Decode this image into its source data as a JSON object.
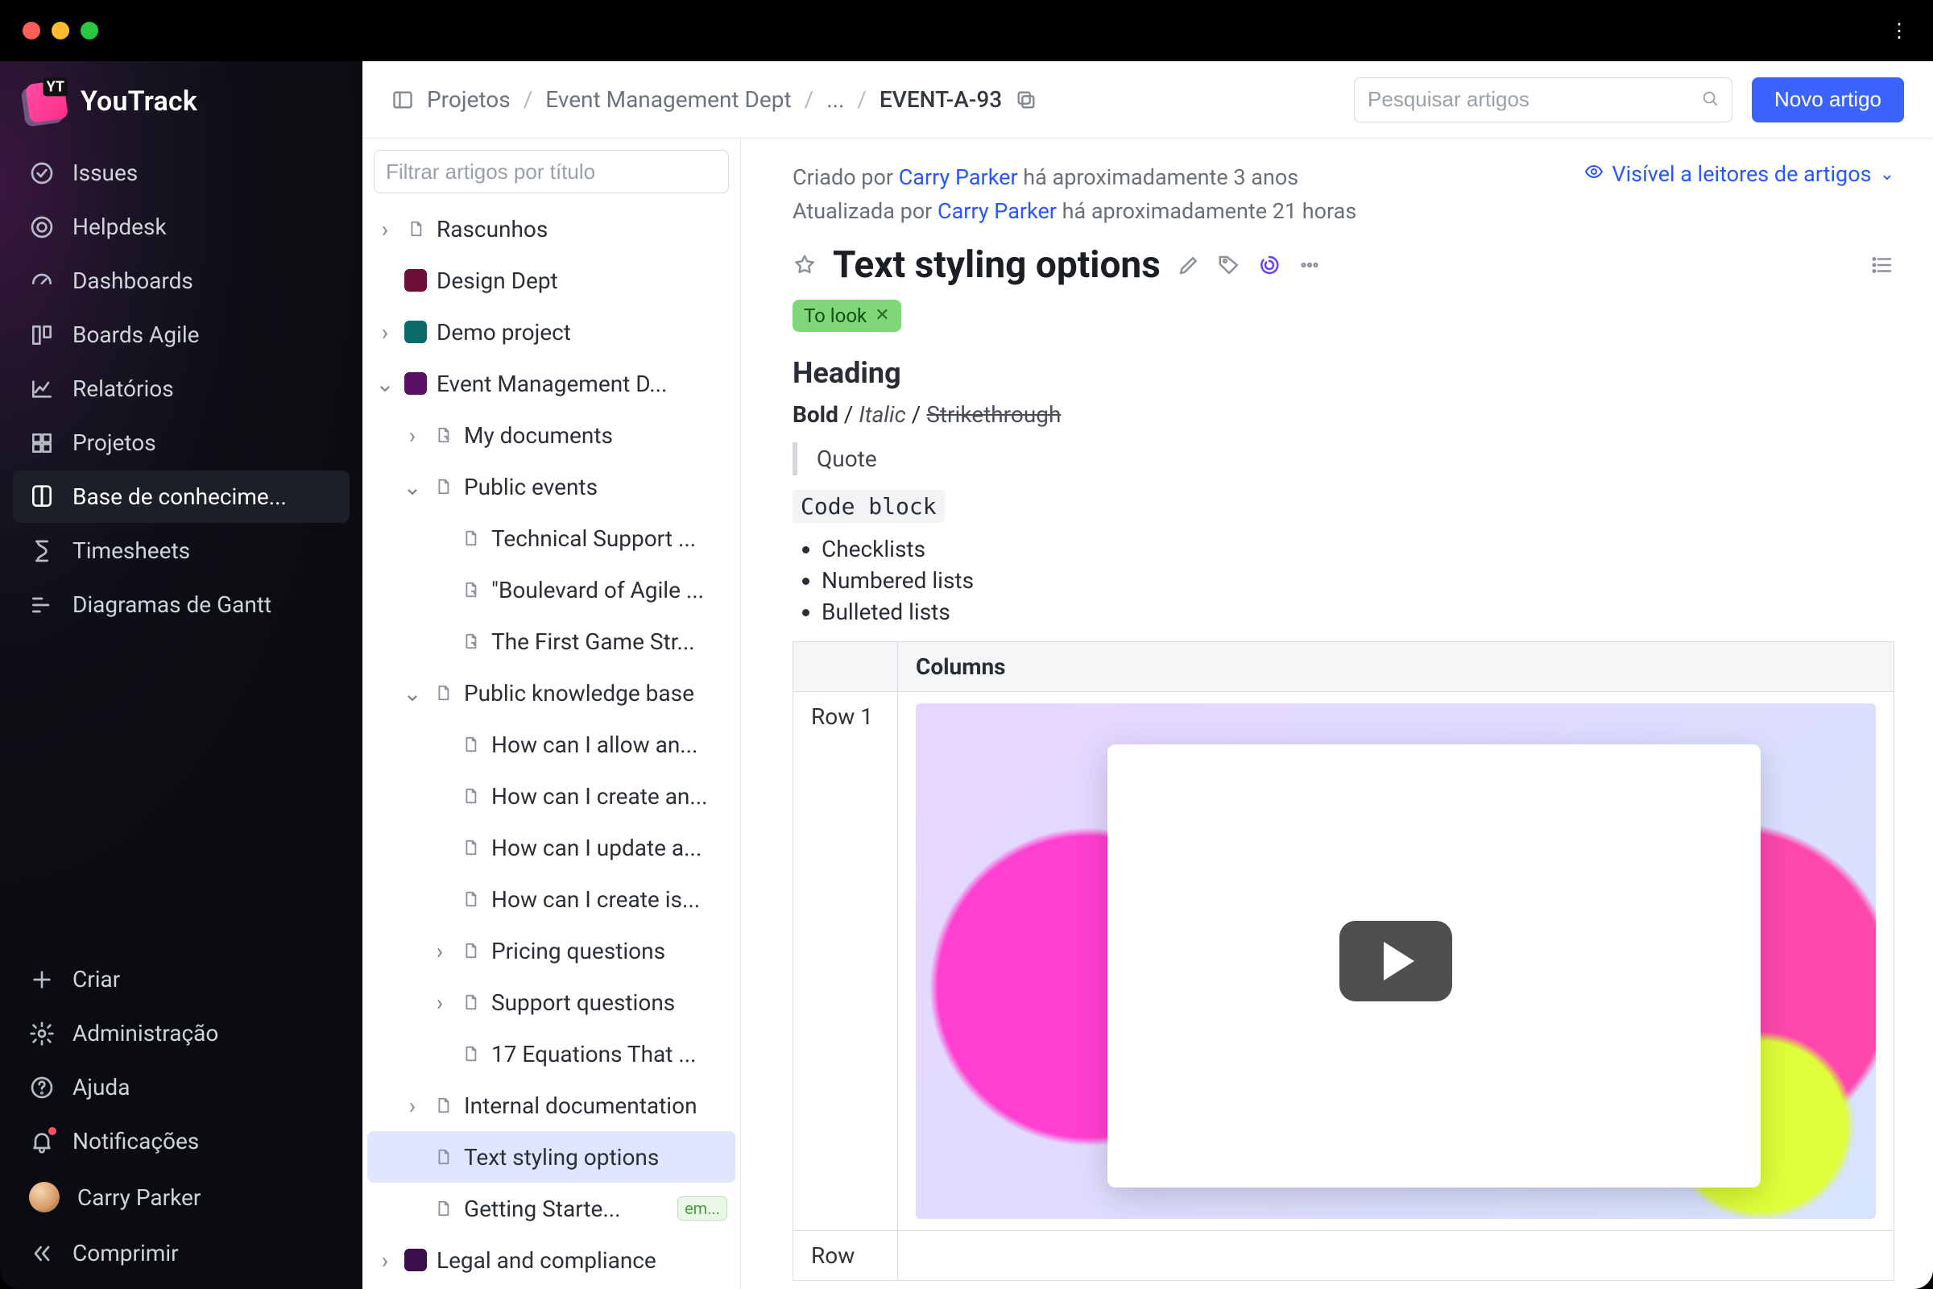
{
  "brand": {
    "name": "YouTrack"
  },
  "sidebar": {
    "items": [
      {
        "label": "Issues",
        "icon": "check-circle-icon"
      },
      {
        "label": "Helpdesk",
        "icon": "lifebuoy-icon"
      },
      {
        "label": "Dashboards",
        "icon": "gauge-icon"
      },
      {
        "label": "Boards Agile",
        "icon": "board-icon"
      },
      {
        "label": "Relatórios",
        "icon": "chart-line-icon"
      },
      {
        "label": "Projetos",
        "icon": "grid-icon"
      },
      {
        "label": "Base de conhecime...",
        "icon": "book-icon"
      },
      {
        "label": "Timesheets",
        "icon": "hourglass-icon"
      },
      {
        "label": "Diagramas de Gantt",
        "icon": "gantt-icon"
      }
    ],
    "bottom": [
      {
        "label": "Criar",
        "icon": "plus-icon"
      },
      {
        "label": "Administração",
        "icon": "gear-icon"
      },
      {
        "label": "Ajuda",
        "icon": "help-icon"
      },
      {
        "label": "Notificações",
        "icon": "bell-icon"
      },
      {
        "label": "Carry Parker",
        "icon": "avatar"
      },
      {
        "label": "Comprimir",
        "icon": "collapse-icon"
      }
    ],
    "activeIndex": 6
  },
  "breadcrumbs": {
    "items": [
      "Projetos",
      "Event Management Dept",
      "...",
      "EVENT-A-93"
    ]
  },
  "search": {
    "placeholder": "Pesquisar artigos"
  },
  "newButton": {
    "label": "Novo artigo"
  },
  "treeFilter": {
    "placeholder": "Filtrar artigos por título"
  },
  "tree": [
    {
      "label": "Rascunhos",
      "depth": 0,
      "arrow": "right",
      "kind": "folder"
    },
    {
      "label": "Design Dept",
      "depth": 0,
      "arrow": "none",
      "kind": "project",
      "color": "#6b1037"
    },
    {
      "label": "Demo project",
      "depth": 0,
      "arrow": "right",
      "kind": "project",
      "color": "#0d6b6b"
    },
    {
      "label": "Event Management D...",
      "depth": 0,
      "arrow": "down",
      "kind": "project",
      "color": "#5b1067"
    },
    {
      "label": "My documents",
      "depth": 1,
      "arrow": "right",
      "kind": "doc-lock"
    },
    {
      "label": "Public events",
      "depth": 1,
      "arrow": "down",
      "kind": "doc"
    },
    {
      "label": "Technical Support ...",
      "depth": 2,
      "arrow": "none",
      "kind": "doc"
    },
    {
      "label": "\"Boulevard of Agile ...",
      "depth": 2,
      "arrow": "none",
      "kind": "doc-lock"
    },
    {
      "label": "The First Game Str...",
      "depth": 2,
      "arrow": "none",
      "kind": "doc-lock"
    },
    {
      "label": "Public knowledge base",
      "depth": 1,
      "arrow": "down",
      "kind": "doc"
    },
    {
      "label": "How can I allow an...",
      "depth": 2,
      "arrow": "none",
      "kind": "doc"
    },
    {
      "label": "How can I create an...",
      "depth": 2,
      "arrow": "none",
      "kind": "doc"
    },
    {
      "label": "How can I update a...",
      "depth": 2,
      "arrow": "none",
      "kind": "doc"
    },
    {
      "label": "How can I create is...",
      "depth": 2,
      "arrow": "none",
      "kind": "doc"
    },
    {
      "label": "Pricing questions",
      "depth": 2,
      "arrow": "right",
      "kind": "doc"
    },
    {
      "label": "Support questions",
      "depth": 2,
      "arrow": "right",
      "kind": "doc"
    },
    {
      "label": "17 Equations That ...",
      "depth": 2,
      "arrow": "none",
      "kind": "doc"
    },
    {
      "label": "Internal documentation",
      "depth": 1,
      "arrow": "right",
      "kind": "doc"
    },
    {
      "label": "Text styling options",
      "depth": 1,
      "arrow": "none",
      "kind": "doc",
      "selected": true
    },
    {
      "label": "Getting Starte...",
      "depth": 1,
      "arrow": "none",
      "kind": "doc",
      "badge": "em..."
    },
    {
      "label": "Legal and compliance",
      "depth": 0,
      "arrow": "right",
      "kind": "project",
      "color": "#3a0f4a"
    }
  ],
  "article": {
    "created_prefix": "Criado por ",
    "created_by": "Carry Parker",
    "created_suffix": " há aproximadamente 3 anos",
    "updated_prefix": "Atualizada por ",
    "updated_by": "Carry Parker",
    "updated_suffix": " há aproximadamente 21 horas",
    "visibility": "Visível a leitores de artigos",
    "title": "Text styling options",
    "tag": "To look",
    "heading": "Heading",
    "bold": "Bold",
    "sep": " / ",
    "italic": "Italic",
    "strike": "Strikethrough",
    "quote": "Quote",
    "code": "Code block",
    "list": [
      "Checklists",
      "Numbered lists",
      "Bulleted lists"
    ],
    "table": {
      "col_blank": "",
      "col_columns": "Columns",
      "row1": "Row 1",
      "row2": "Row"
    }
  }
}
